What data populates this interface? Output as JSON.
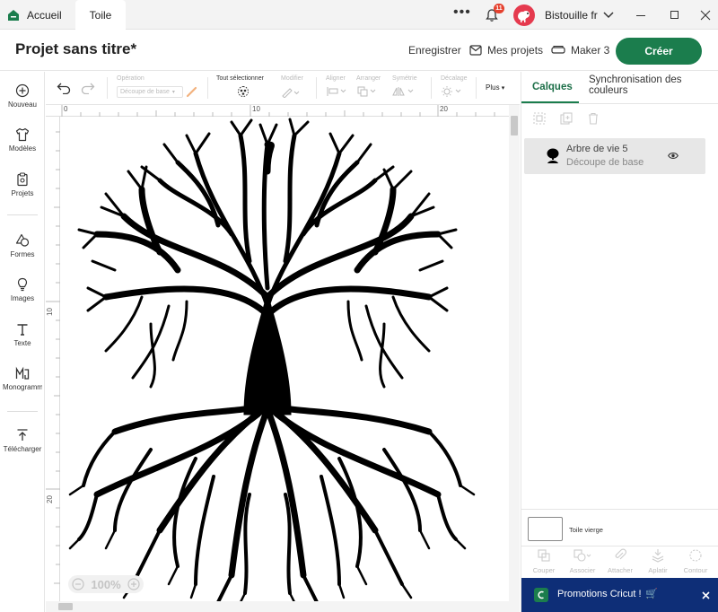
{
  "titlebar": {
    "home_tab": "Accueil",
    "canvas_tab": "Toile",
    "notification_count": "11",
    "user_name": "Bistouille fr"
  },
  "header": {
    "project_title": "Projet sans titre*",
    "save": "Enregistrer",
    "my_projects": "Mes projets",
    "machine": "Maker 3",
    "create": "Créer"
  },
  "sidebar": {
    "items": [
      {
        "label": "Nouveau",
        "icon": "plus-circle-icon"
      },
      {
        "label": "Modèles",
        "icon": "shirt-icon"
      },
      {
        "label": "Projets",
        "icon": "clipboard-icon"
      },
      {
        "label": "Formes",
        "icon": "shapes-icon"
      },
      {
        "label": "Images",
        "icon": "bulb-icon"
      },
      {
        "label": "Texte",
        "icon": "text-icon"
      },
      {
        "label": "Monogramme",
        "icon": "monogram-icon"
      },
      {
        "label": "Télécharger",
        "icon": "upload-icon"
      }
    ]
  },
  "toolbar": {
    "operation_label": "Opération",
    "operation_value": "Découpe de base",
    "select_all": "Tout sélectionner",
    "edit": "Modifier",
    "align": "Aligner",
    "arrange": "Arranger",
    "symmetry": "Symétrie",
    "offset": "Décalage",
    "more": "Plus"
  },
  "ruler": {
    "top_ticks": [
      "0",
      "10",
      "20"
    ],
    "left_ticks": [
      "10",
      "20"
    ]
  },
  "zoom": {
    "level": "100%"
  },
  "layers_panel": {
    "tab_layers": "Calques",
    "tab_sync_line1": "Synchronisation des",
    "tab_sync_line2": "couleurs",
    "layer_name": "Arbre de vie 5",
    "layer_operation": "Découpe de base",
    "blank_canvas": "Toile vierge",
    "bottom_actions": [
      "Couper",
      "Associer",
      "Attacher",
      "Aplatir",
      "Contour"
    ]
  },
  "promo": {
    "text": "Promotions Cricut !"
  },
  "colors": {
    "accent_green": "#1b7d4d",
    "promo_navy": "#0e2e77",
    "notification_red": "#e5412e"
  }
}
